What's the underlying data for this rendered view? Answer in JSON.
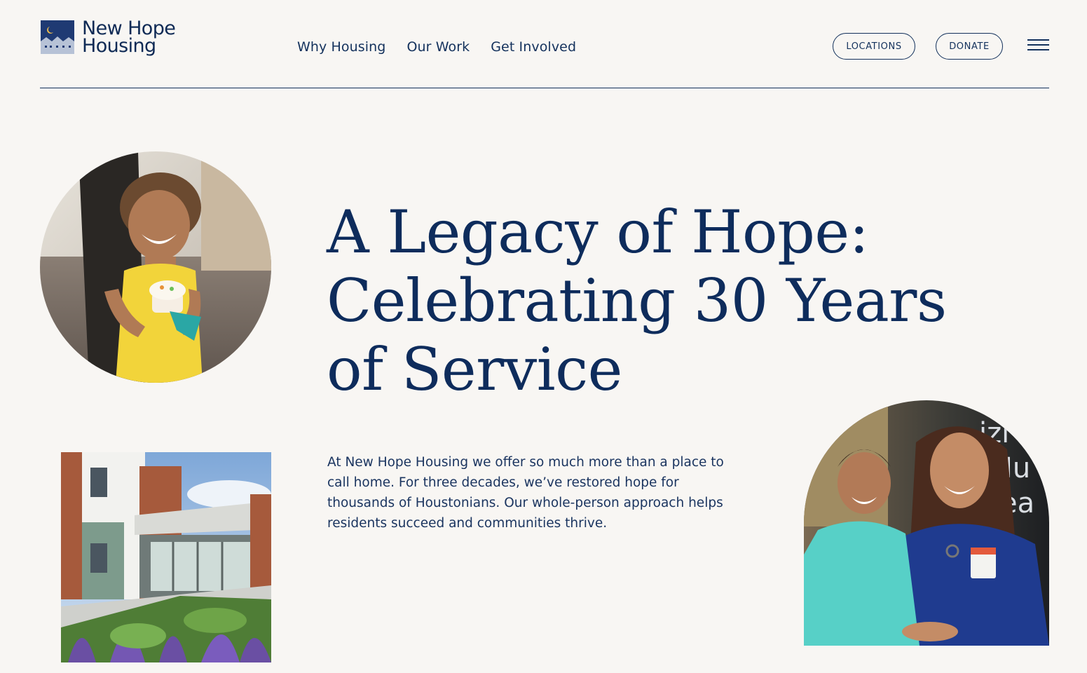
{
  "header": {
    "logo": {
      "line1": "New Hope",
      "line2": "Housing",
      "icon": "moon-houses-logo-icon"
    },
    "nav": [
      {
        "label": "Why Housing"
      },
      {
        "label": "Our Work"
      },
      {
        "label": "Get Involved"
      }
    ],
    "locations_label": "LOCATIONS",
    "donate_label": "DONATE",
    "menu_icon": "hamburger-menu-icon"
  },
  "hero": {
    "headline_lines": [
      "A Legacy of Hope:",
      "Celebrating 30 Years",
      "of Service"
    ],
    "intro": "At New Hope Housing we offer so much more than a place to call home. For three decades, we’ve restored hope for thousands of Houstonians. Our whole-person approach helps residents succeed and communities thrive."
  },
  "colors": {
    "background": "#f8f6f3",
    "navy": "#13315c",
    "headline": "#0e2c5c",
    "logo_sky": "#1f3a73",
    "logo_moon": "#f2c14e"
  }
}
